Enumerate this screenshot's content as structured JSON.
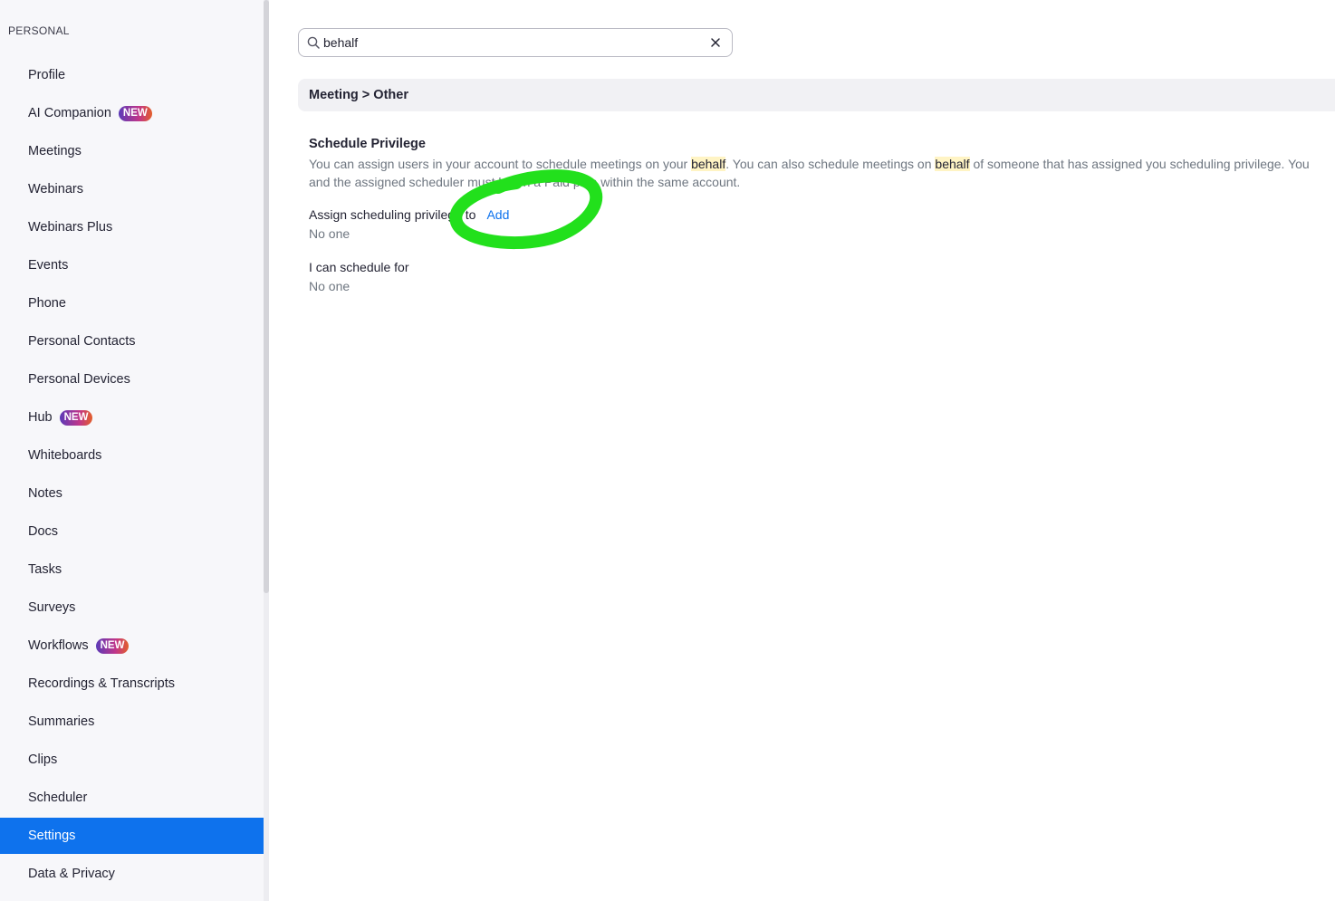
{
  "sidebar": {
    "section_title": "PERSONAL",
    "items": [
      {
        "label": "Profile"
      },
      {
        "label": "AI Companion",
        "badge": "NEW"
      },
      {
        "label": "Meetings"
      },
      {
        "label": "Webinars"
      },
      {
        "label": "Webinars Plus"
      },
      {
        "label": "Events"
      },
      {
        "label": "Phone"
      },
      {
        "label": "Personal Contacts"
      },
      {
        "label": "Personal Devices"
      },
      {
        "label": "Hub",
        "badge": "NEW"
      },
      {
        "label": "Whiteboards"
      },
      {
        "label": "Notes"
      },
      {
        "label": "Docs"
      },
      {
        "label": "Tasks"
      },
      {
        "label": "Surveys"
      },
      {
        "label": "Workflows",
        "badge": "NEW"
      },
      {
        "label": "Recordings & Transcripts"
      },
      {
        "label": "Summaries"
      },
      {
        "label": "Clips"
      },
      {
        "label": "Scheduler"
      },
      {
        "label": "Settings",
        "active": true
      },
      {
        "label": "Data & Privacy"
      }
    ]
  },
  "search": {
    "value": "behalf",
    "search_icon": "search-icon",
    "clear_icon": "close-icon"
  },
  "breadcrumb": "Meeting > Other",
  "setting": {
    "title": "Schedule Privilege",
    "desc_part1": "You can assign users in your account to schedule meetings on your ",
    "desc_hl1": "behalf",
    "desc_part2": ". You can also schedule meetings on ",
    "desc_hl2": "behalf",
    "desc_part3": " of someone that has assigned you scheduling privilege. You and the assigned scheduler must be on a Paid plan within the same account.",
    "assign_label": "Assign scheduling privilege to",
    "add_label": "Add",
    "assign_value": "No one",
    "schedule_for_label": "I can schedule for",
    "schedule_for_value": "No one"
  },
  "colors": {
    "accent": "#0e72ed",
    "highlight": "#fff4c4",
    "annotation": "#22e01c"
  }
}
